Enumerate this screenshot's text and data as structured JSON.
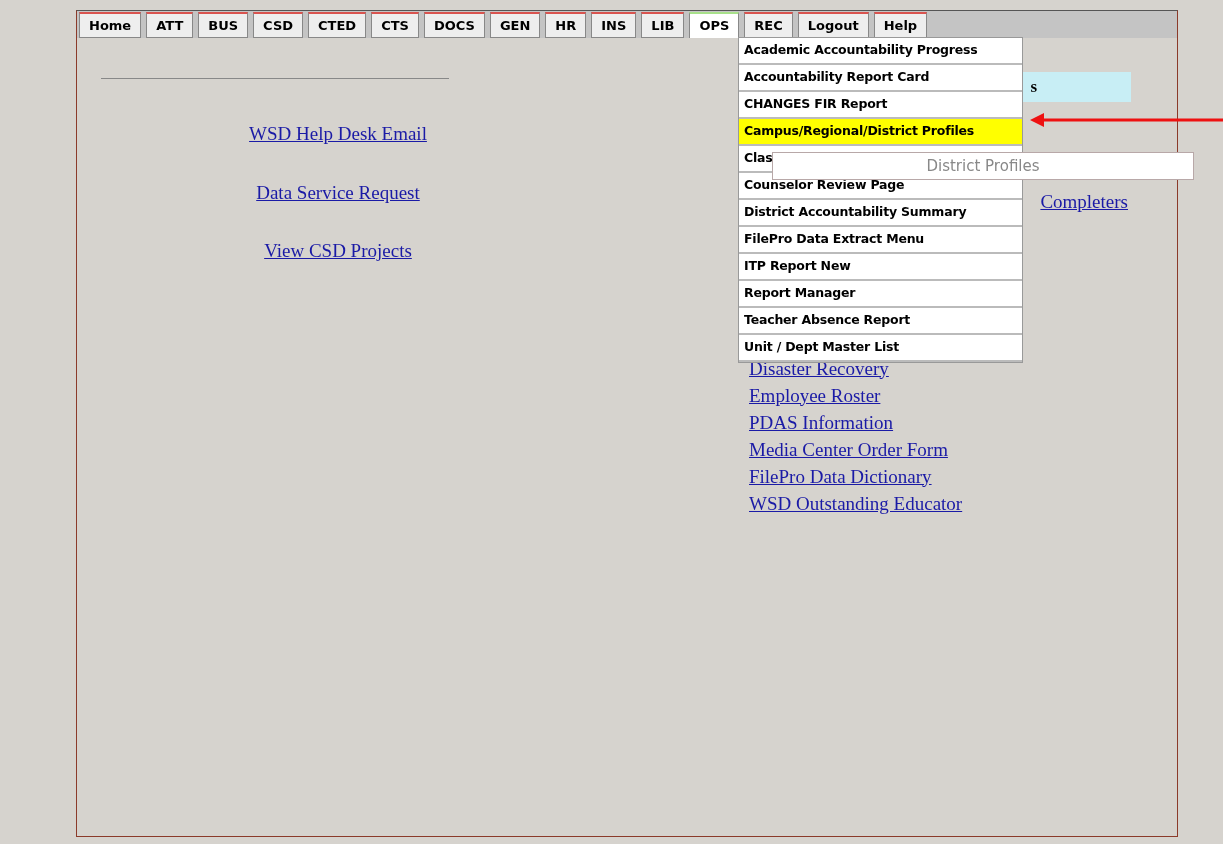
{
  "tabs": [
    {
      "label": "Home",
      "selected": false
    },
    {
      "label": "ATT",
      "selected": false
    },
    {
      "label": "BUS",
      "selected": false
    },
    {
      "label": "CSD",
      "selected": false
    },
    {
      "label": "CTED",
      "selected": false
    },
    {
      "label": "CTS",
      "selected": false
    },
    {
      "label": "DOCS",
      "selected": false
    },
    {
      "label": "GEN",
      "selected": false
    },
    {
      "label": "HR",
      "selected": false
    },
    {
      "label": "INS",
      "selected": false
    },
    {
      "label": "LIB",
      "selected": false
    },
    {
      "label": "OPS",
      "selected": true
    },
    {
      "label": "REC",
      "selected": false
    },
    {
      "label": "Logout",
      "selected": false
    },
    {
      "label": "Help",
      "selected": false
    }
  ],
  "left_links": [
    "WSD Help Desk Email",
    "Data Service Request",
    "View CSD Projects"
  ],
  "right_panel": {
    "heading_fragment": "s",
    "link_fragment": "Completers",
    "links": [
      "Disaster Recovery",
      "Employee Roster",
      "PDAS Information",
      "Media Center Order Form",
      "FilePro Data Dictionary",
      "WSD Outstanding Educator"
    ]
  },
  "dropdown_menu": {
    "items": [
      {
        "label": "Academic Accountability Progress",
        "selected": false
      },
      {
        "label": "Accountability Report Card",
        "selected": false
      },
      {
        "label": "CHANGES FIR Report",
        "selected": false
      },
      {
        "label": "Campus/Regional/District Profiles",
        "selected": true
      },
      {
        "label": "Clas",
        "selected": false
      },
      {
        "label": "Counselor Review Page",
        "selected": false
      },
      {
        "label": "District Accountability Summary",
        "selected": false
      },
      {
        "label": "FilePro Data Extract Menu",
        "selected": false
      },
      {
        "label": "ITP Report New",
        "selected": false
      },
      {
        "label": "Report Manager",
        "selected": false
      },
      {
        "label": "Teacher Absence Report",
        "selected": false
      },
      {
        "label": "Unit / Dept Master List",
        "selected": false
      }
    ]
  },
  "tooltip": "District Profiles"
}
